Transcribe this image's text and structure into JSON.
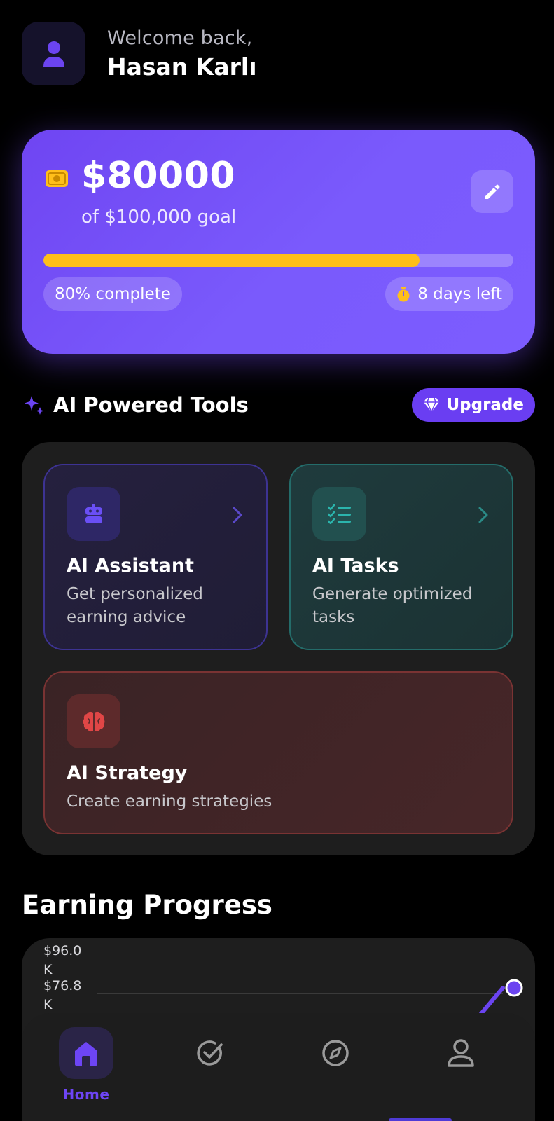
{
  "header": {
    "welcome": "Welcome back,",
    "name": "Hasan Karlı"
  },
  "goal": {
    "amount": "$80000",
    "subtitle": "of $100,000 goal",
    "progress_percent": 80,
    "complete_label": "80% complete",
    "days_left_label": "8 days left"
  },
  "tools_section": {
    "title": "AI Powered Tools",
    "upgrade_label": "Upgrade",
    "tools": [
      {
        "title": "AI Assistant",
        "desc": "Get personalized earning advice",
        "icon": "robot-icon",
        "accent": "#6a4ff5"
      },
      {
        "title": "AI Tasks",
        "desc": "Generate optimized tasks",
        "icon": "task-list-icon",
        "accent": "#2bb5ad"
      },
      {
        "title": "AI Strategy",
        "desc": "Create earning strategies",
        "icon": "brain-icon",
        "accent": "#e04646"
      }
    ]
  },
  "earning": {
    "title": "Earning Progress"
  },
  "chart_data": {
    "type": "line",
    "y_ticks": [
      "$96.0\nK",
      "$76.8\nK"
    ],
    "series": [
      {
        "values": [
          80000
        ]
      }
    ]
  },
  "nav": {
    "items": [
      {
        "label": "Home",
        "icon": "home-icon",
        "active": true
      },
      {
        "label": "",
        "icon": "check-circle-icon",
        "active": false
      },
      {
        "label": "",
        "icon": "compass-icon",
        "active": false
      },
      {
        "label": "",
        "icon": "profile-icon",
        "active": false
      }
    ]
  },
  "colors": {
    "accent": "#6a3ef2",
    "progress": "#ffbf1a"
  }
}
